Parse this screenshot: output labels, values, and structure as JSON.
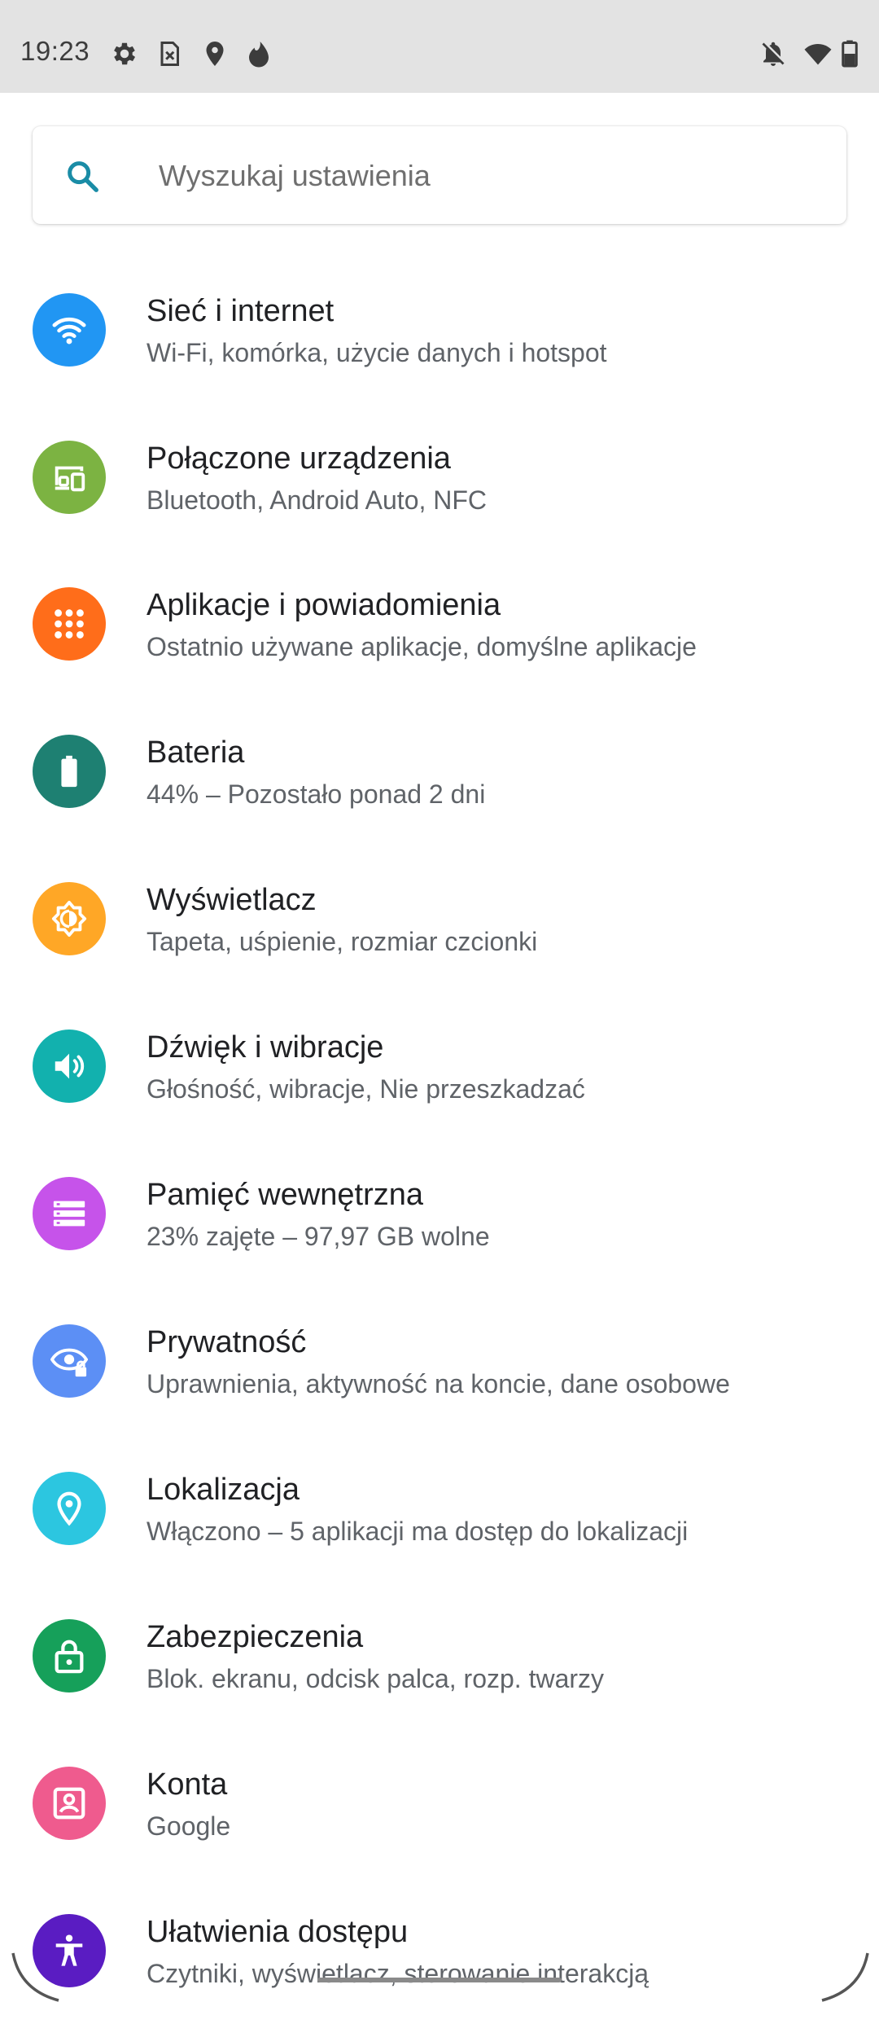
{
  "status_bar": {
    "time": "19:23",
    "left_icons": [
      "gear-icon",
      "sim-icon",
      "location-pin-icon",
      "fire-icon"
    ],
    "right_icons": [
      "notifications-off-icon",
      "wifi-icon",
      "battery-icon"
    ]
  },
  "search": {
    "placeholder": "Wyszukaj ustawienia"
  },
  "settings": [
    {
      "title": "Sieć i internet",
      "subtitle": "Wi-Fi, komórka, użycie danych i hotspot",
      "icon": "wifi-icon",
      "color": "#2196f3"
    },
    {
      "title": "Połączone urządzenia",
      "subtitle": "Bluetooth, Android Auto, NFC",
      "icon": "devices-icon",
      "color": "#7cb342"
    },
    {
      "title": "Aplikacje i powiadomienia",
      "subtitle": "Ostatnio używane aplikacje, domyślne aplikacje",
      "icon": "apps-grid-icon",
      "color": "#ff6d1a"
    },
    {
      "title": "Bateria",
      "subtitle": "44% – Pozostało ponad 2 dni",
      "icon": "battery-icon",
      "color": "#1e8072"
    },
    {
      "title": "Wyświetlacz",
      "subtitle": "Tapeta, uśpienie, rozmiar czcionki",
      "icon": "brightness-icon",
      "color": "#ffa726"
    },
    {
      "title": "Dźwięk i wibracje",
      "subtitle": "Głośność, wibracje, Nie przeszkadzać",
      "icon": "volume-icon",
      "color": "#12b1ae"
    },
    {
      "title": "Pamięć wewnętrzna",
      "subtitle": "23% zajęte – 97,97 GB wolne",
      "icon": "storage-icon",
      "color": "#c653ea"
    },
    {
      "title": "Prywatność",
      "subtitle": "Uprawnienia, aktywność na koncie, dane osobowe",
      "icon": "privacy-eye-icon",
      "color": "#5c8ff5"
    },
    {
      "title": "Lokalizacja",
      "subtitle": "Włączono – 5 aplikacji ma dostęp do lokalizacji",
      "icon": "location-icon",
      "color": "#2cc6e0"
    },
    {
      "title": "Zabezpieczenia",
      "subtitle": "Blok. ekranu, odcisk palca, rozp. twarzy",
      "icon": "lock-icon",
      "color": "#16a05a"
    },
    {
      "title": "Konta",
      "subtitle": "Google",
      "icon": "account-icon",
      "color": "#ef5b8e"
    },
    {
      "title": "Ułatwienia dostępu",
      "subtitle": "Czytniki, wyświetlacz, sterowanie interakcją",
      "icon": "accessibility-icon",
      "color": "#5a1cc2"
    }
  ]
}
